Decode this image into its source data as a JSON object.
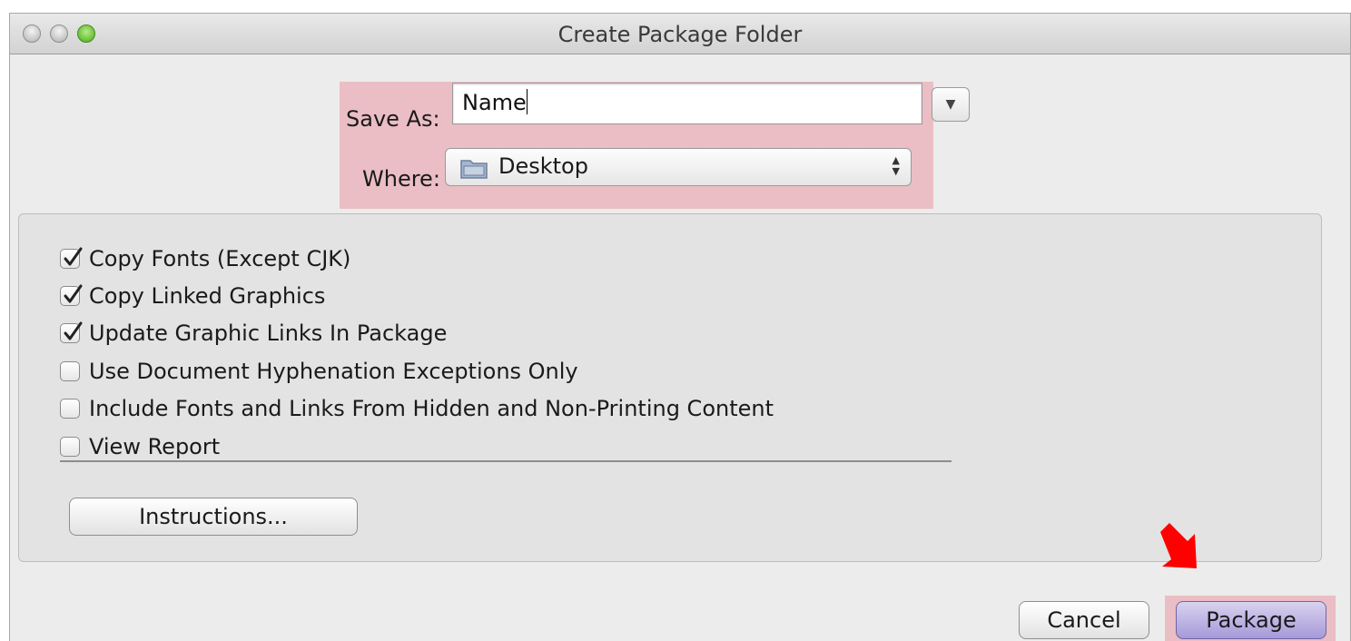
{
  "window": {
    "title": "Create Package Folder"
  },
  "save_as": {
    "label": "Save As:",
    "value": "Name"
  },
  "where": {
    "label": "Where:",
    "selected": "Desktop"
  },
  "options": [
    {
      "label": "Copy Fonts (Except CJK)",
      "checked": true
    },
    {
      "label": "Copy Linked Graphics",
      "checked": true
    },
    {
      "label": "Update Graphic Links In Package",
      "checked": true
    },
    {
      "label": "Use Document Hyphenation Exceptions Only",
      "checked": false
    },
    {
      "label": "Include Fonts and Links From Hidden and Non-Printing Content",
      "checked": false
    },
    {
      "label": "View Report",
      "checked": false
    }
  ],
  "buttons": {
    "instructions": "Instructions...",
    "cancel": "Cancel",
    "package": "Package"
  },
  "colors": {
    "highlight": "#eaa0aa",
    "arrow": "#ff0000",
    "default_button": "#a69ad8"
  },
  "icons": [
    "close-icon",
    "minimize-icon",
    "zoom-icon",
    "disclosure-triangle-icon",
    "folder-icon",
    "updown-arrows-icon",
    "checkmark-icon",
    "red-arrow-icon"
  ]
}
